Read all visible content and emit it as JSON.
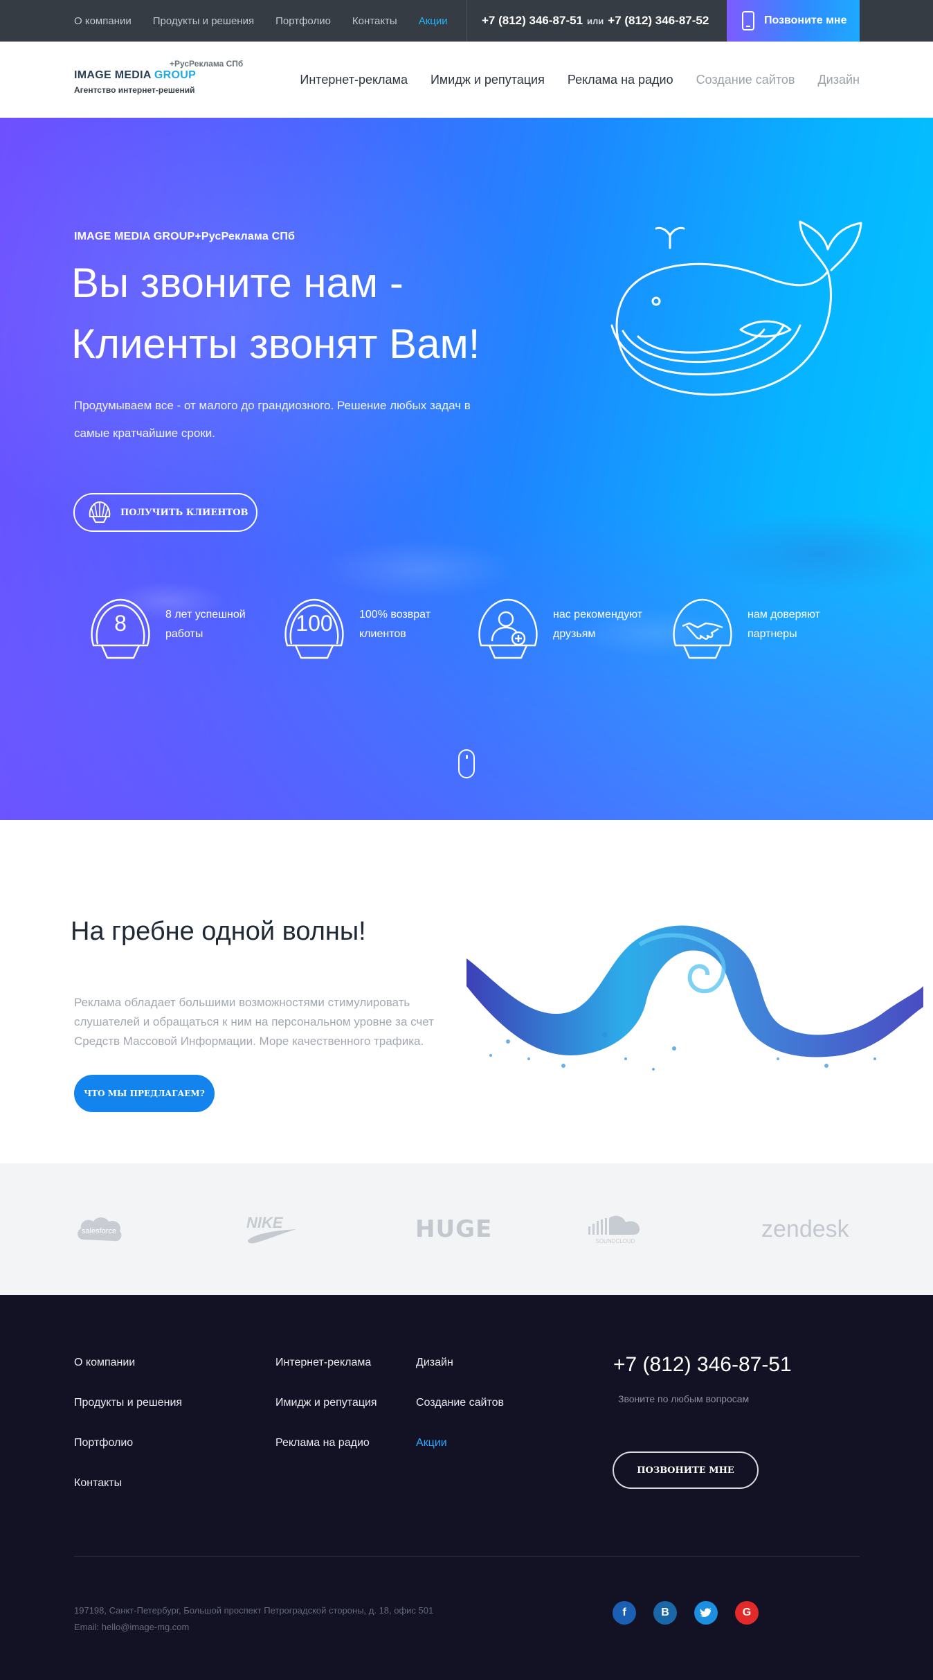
{
  "topbar": {
    "nav": [
      "О компании",
      "Продукты и решения",
      "Портфолио",
      "Контакты",
      "Акции"
    ],
    "phone1": "+7 (812) 346-87-51",
    "or": "или",
    "phone2": "+7 (812) 346-87-52",
    "callme": "Позвоните мне",
    "accent_color": "#22b6ff"
  },
  "header": {
    "logo_top": "+РусРеклама СПб",
    "logo_main_a": "IMAGE MEDIA",
    "logo_main_b": "GROUP",
    "logo_sub": "Агентство интернет-решений",
    "nav": [
      "Интернет-реклама",
      "Имидж и репутация",
      "Реклама на радио",
      "Создание сайтов",
      "Дизайн"
    ]
  },
  "hero": {
    "kicker": "IMAGE MEDIA GROUP+РусРеклама СПб",
    "title_line1": "Вы звоните нам -",
    "title_line2": "Клиенты звонят Вам!",
    "desc": "Продумываем все - от малого до грандиозного. Решение любых задач в самые кратчайшие сроки.",
    "button": "ПОЛУЧИТЬ КЛИЕНТОВ",
    "stats": [
      {
        "value": "8",
        "text": "8 лет успешной работы",
        "icon": "shell-icon"
      },
      {
        "value": "100",
        "text": "100% возврат клиентов",
        "icon": "shell-icon"
      },
      {
        "value": "",
        "text": "нас рекомендуют друзьям",
        "icon": "user-plus-icon"
      },
      {
        "value": "",
        "text": "нам доверяют партнеры",
        "icon": "handshake-icon"
      }
    ]
  },
  "wave": {
    "title": "На гребне одной волны!",
    "text": "Реклама обладает большими возможностями стимулировать слушателей и обращаться к ним на персональном уровне за счет Средств Массовой Информации. Море качественного трафика.",
    "button": "ЧТО МЫ ПРЕДЛАГАЕМ?",
    "button_color": "#1383ee"
  },
  "partners": {
    "salesforce": "salesforce",
    "nike": "NIKE",
    "huge": "HUGE",
    "soundcloud": "SOUNDCLOUD",
    "zendesk": "zendesk"
  },
  "footer": {
    "col1": [
      "О компании",
      "Продукты и решения",
      "Портфолио",
      "Контакты"
    ],
    "col2": [
      "Интернет-реклама",
      "Имидж и репутация",
      "Реклама на радио"
    ],
    "col3": [
      "Дизайн",
      "Создание сайтов",
      "Акции"
    ],
    "phone": "+7 (812) 346-87-51",
    "phone_note": "Звоните по любым вопросам",
    "callme": "ПОЗВОНИТЕ МНЕ",
    "address": "197198, Санкт-Петербург, Большой проспект Петроградской стороны, д. 18, офис 501",
    "email": "Email: hello@image-mg.com",
    "social": [
      {
        "icon": "facebook-icon",
        "label": "f",
        "color": "#1a5fb4"
      },
      {
        "icon": "vk-icon",
        "label": "B",
        "color": "#1a67a8"
      },
      {
        "icon": "twitter-icon",
        "label": "t",
        "color": "#1c8fe0"
      },
      {
        "icon": "google-icon",
        "label": "G",
        "color": "#e22a2a"
      }
    ]
  }
}
